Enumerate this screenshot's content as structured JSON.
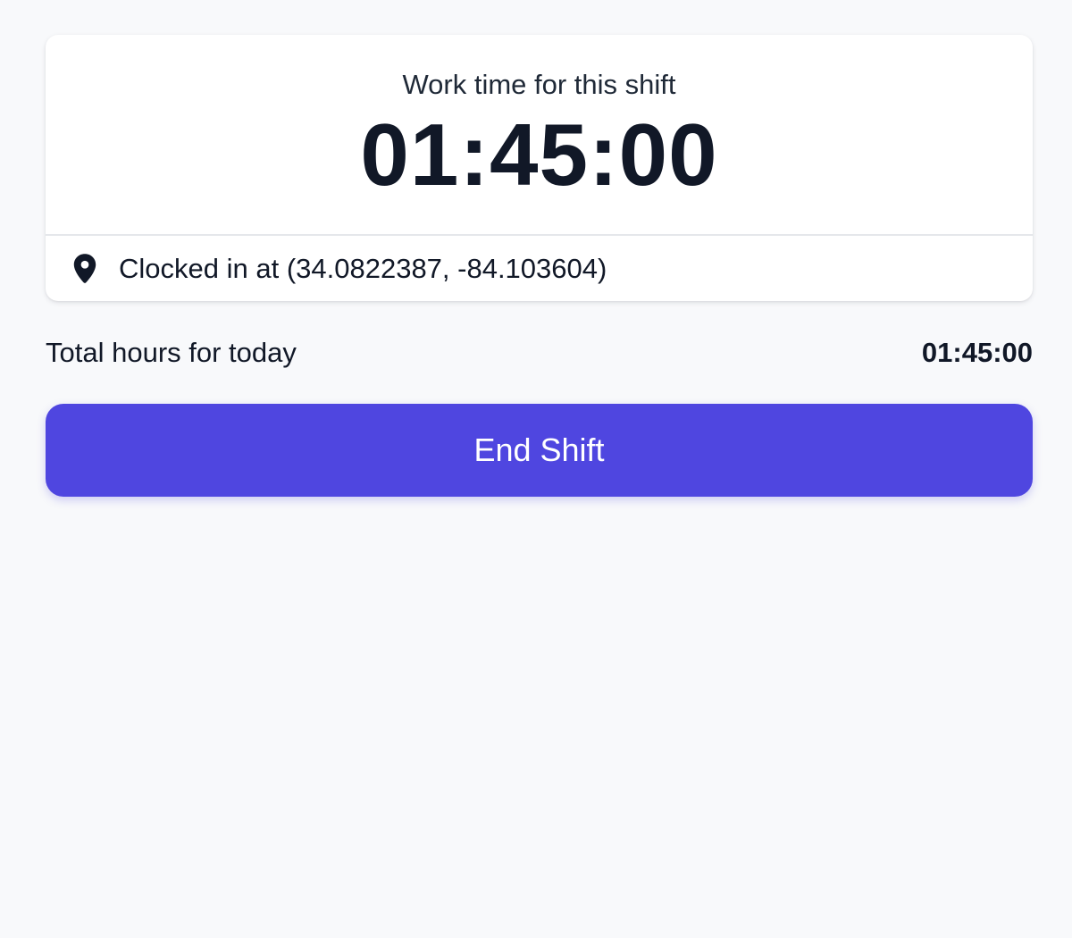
{
  "shift_card": {
    "label": "Work time for this shift",
    "timer": "01:45:00",
    "location_icon": "map-pin-icon",
    "location_text": "Clocked in at (34.0822387, -84.103604)"
  },
  "summary": {
    "label": "Total hours for today",
    "value": "01:45:00"
  },
  "actions": {
    "end_shift_label": "End Shift"
  },
  "colors": {
    "background": "#f8f9fb",
    "card": "#ffffff",
    "accent": "#4f46e0",
    "text": "#111827"
  }
}
